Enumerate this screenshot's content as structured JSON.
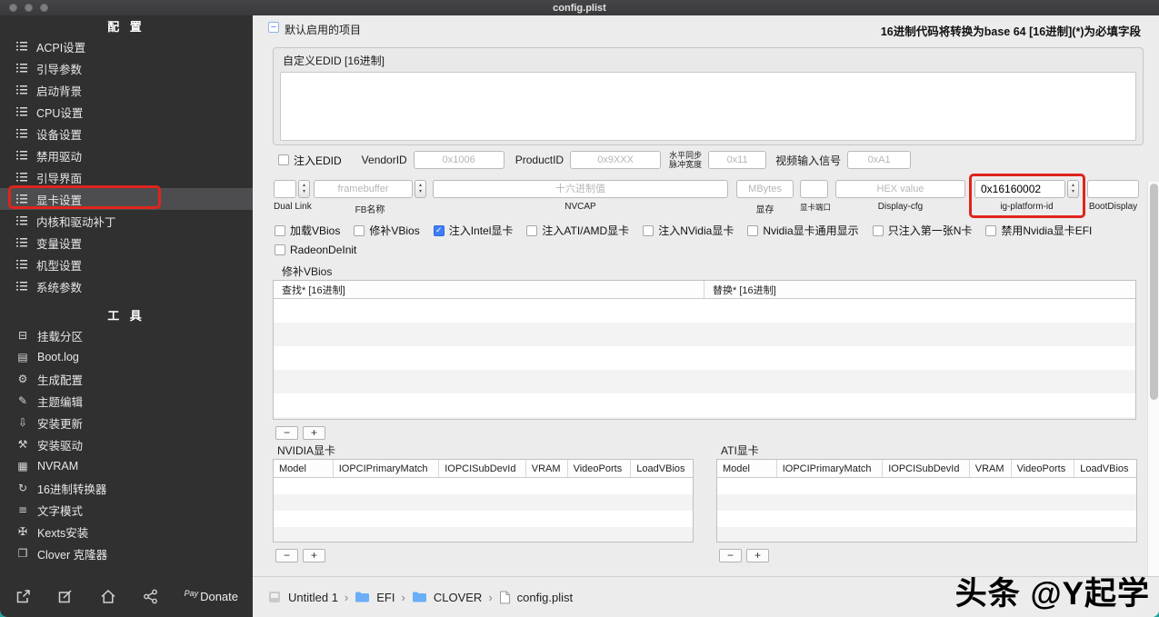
{
  "window": {
    "title": "config.plist"
  },
  "sidebar": {
    "config_header": "配  置",
    "config_items": [
      "ACPI设置",
      "引导参数",
      "启动背景",
      "CPU设置",
      "设备设置",
      "禁用驱动",
      "引导界面",
      "显卡设置",
      "内核和驱动补丁",
      "变量设置",
      "机型设置",
      "系统参数"
    ],
    "tools_header": "工  具",
    "tools_items": [
      {
        "icon": "⊟",
        "label": "挂载分区"
      },
      {
        "icon": "▤",
        "label": "Boot.log"
      },
      {
        "icon": "⚙",
        "label": "生成配置"
      },
      {
        "icon": "✎",
        "label": "主题编辑"
      },
      {
        "icon": "⇩",
        "label": "安装更新"
      },
      {
        "icon": "⚒",
        "label": "安装驱动"
      },
      {
        "icon": "▦",
        "label": "NVRAM"
      },
      {
        "icon": "↻",
        "label": "16进制转换器"
      },
      {
        "icon": "≡",
        "label": "文字模式"
      },
      {
        "icon": "✠",
        "label": "Kexts安装"
      },
      {
        "icon": "❐",
        "label": "Clover 克隆器"
      }
    ],
    "selected_item": "显卡设置",
    "donate": {
      "pay": "Pay",
      "label": "Donate"
    }
  },
  "topbar": {
    "default_item_label": "默认启用的项目",
    "hint": "16进制代码将转换为base 64 [16进制](*)为必填字段"
  },
  "edid": {
    "group_title": "自定义EDID [16进制]",
    "inject_label": "注入EDID",
    "vendor_label": "VendorID",
    "vendor_placeholder": "0x1006",
    "product_label": "ProductID",
    "product_placeholder": "0x9XXX",
    "hsync_line1": "水平同步",
    "hsync_line2": "脉冲宽度",
    "hsync_placeholder": "0x11",
    "video_label": "视频输入信号",
    "video_placeholder": "0xA1"
  },
  "controls": {
    "dual_link": {
      "label": "Dual Link"
    },
    "fb_name": {
      "label": "FB名称",
      "placeholder": "framebuffer"
    },
    "nvcap": {
      "label": "NVCAP",
      "placeholder": "十六进制值"
    },
    "vram": {
      "label": "显存",
      "placeholder": "MBytes"
    },
    "ports": {
      "label": "显卡端口"
    },
    "display_cfg": {
      "label": "Display-cfg",
      "placeholder": "HEX value"
    },
    "ig_platform_id": {
      "label": "ig-platform-id",
      "value": "0x16160002"
    },
    "boot_display": {
      "label": "BootDisplay"
    }
  },
  "vbios_checkboxes": [
    {
      "label": "加载VBios",
      "checked": false
    },
    {
      "label": "修补VBios",
      "checked": false
    },
    {
      "label": "注入Intel显卡",
      "checked": true
    },
    {
      "label": "注入ATI/AMD显卡",
      "checked": false
    },
    {
      "label": "注入NVidia显卡",
      "checked": false
    },
    {
      "label": "Nvidia显卡通用显示",
      "checked": false
    },
    {
      "label": "只注入第一张N卡",
      "checked": false
    },
    {
      "label": "禁用Nvidia显卡EFI",
      "checked": false
    }
  ],
  "radeon": {
    "label": "RadeonDeInit",
    "checked": false
  },
  "patch_table": {
    "title": "修补VBios",
    "col_find": "查找* [16进制]",
    "col_replace": "替换* [16进制]"
  },
  "gpu_tables": {
    "nvidia_title": "NVIDIA显卡",
    "ati_title": "ATI显卡",
    "columns": [
      "Model",
      "IOPCIPrimaryMatch",
      "IOPCISubDevId",
      "VRAM",
      "VideoPorts",
      "LoadVBios"
    ]
  },
  "glyphs": {
    "check": "✓",
    "up": "▴",
    "down": "▾",
    "minus": "−",
    "plus": "+",
    "collapse": "−"
  },
  "footer": {
    "breadcrumb": [
      "Untitled 1",
      "EFI",
      "CLOVER",
      "config.plist"
    ],
    "separator": "›"
  },
  "watermark": "头条 @Y起学",
  "colors": {
    "annotation_red": "#df241d",
    "accent_blue": "#3d7ef7",
    "selection_gray": "#4d4d4f"
  }
}
